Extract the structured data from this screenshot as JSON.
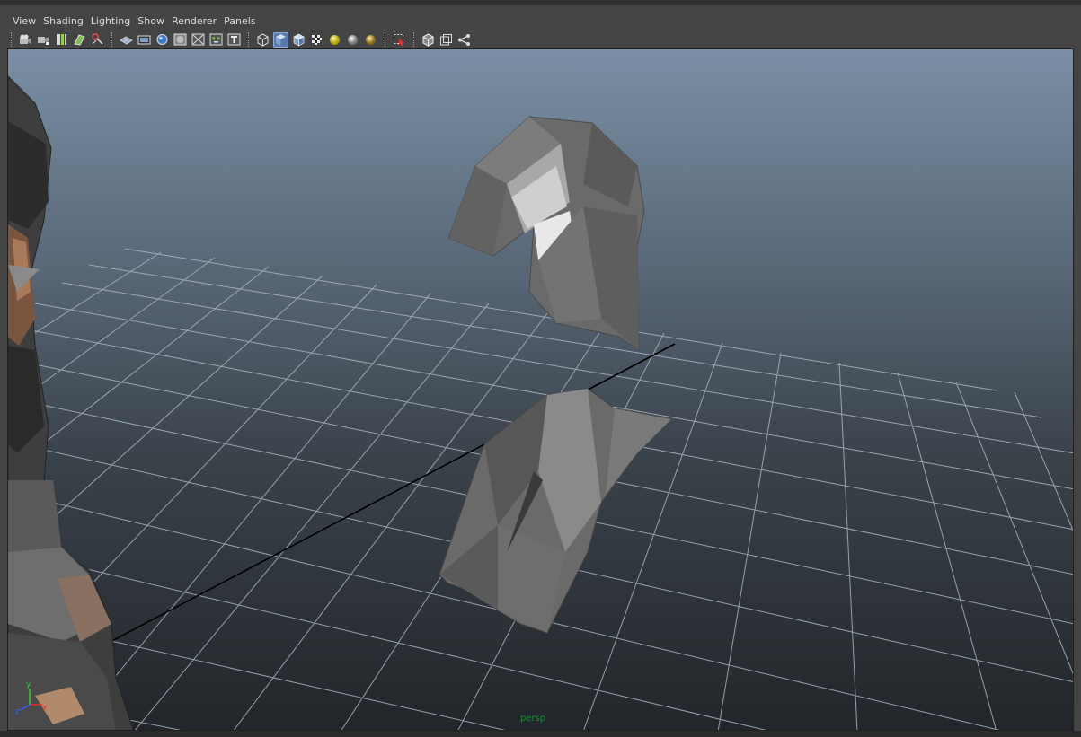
{
  "menubar": {
    "items": [
      "View",
      "Shading",
      "Lighting",
      "Show",
      "Renderer",
      "Panels"
    ]
  },
  "toolbar": {
    "groups": [
      [
        "select-camera-icon",
        "camera-attributes-icon",
        "bookmarks-icon",
        "image-plane-icon",
        "2d-pan-zoom-icon"
      ],
      [
        "grid-icon",
        "film-gate-icon",
        "resolution-gate-icon",
        "gate-mask-icon",
        "field-chart-icon",
        "safe-action-icon",
        "safe-title-icon"
      ],
      [
        "wireframe-icon",
        "smooth-shade-icon",
        "wireframe-on-shaded-icon",
        "textured-icon",
        "use-all-lights-icon",
        "shadows-icon",
        "ambient-occlusion-icon"
      ],
      [
        "isolate-select-icon"
      ],
      [
        "xray-icon",
        "xray-joints-icon",
        "backface-icon"
      ]
    ],
    "active": [
      "smooth-shade-icon"
    ]
  },
  "viewport": {
    "camera_label": "persp",
    "axis_labels": {
      "x": "x",
      "y": "y",
      "z": "z"
    }
  },
  "colors": {
    "axis_x": "#e03030",
    "axis_y": "#30d030",
    "axis_z": "#3060ff",
    "grid": "#aab4c0",
    "mesh": "#6e6e6e"
  }
}
